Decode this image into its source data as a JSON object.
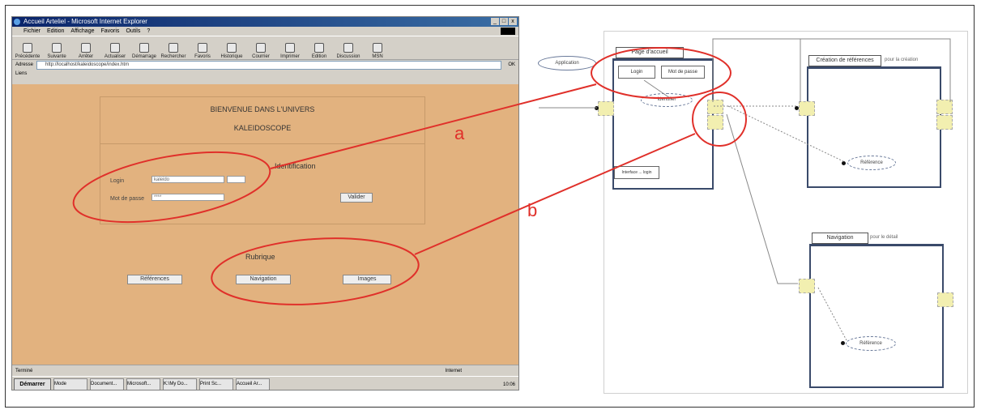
{
  "browser": {
    "title": "Accueil Arteliel - Microsoft Internet Explorer",
    "window_controls": [
      "_",
      "□",
      "x"
    ],
    "menu": [
      "Fichier",
      "Edition",
      "Affichage",
      "Favoris",
      "Outils",
      "?"
    ],
    "toolbar": [
      "Précédente",
      "Suivante",
      "Arrêter",
      "Actualiser",
      "Démarrage",
      "Rechercher",
      "Favoris",
      "Historique",
      "Courrier",
      "Imprimer",
      "Edition",
      "Discussion",
      "MSN"
    ],
    "address_label": "Adresse",
    "address_value": "http://localhost/kaleidoscope/index.htm",
    "go_label": "OK",
    "links_label": "Liens",
    "status_text": "Terminé",
    "status_zone": "Internet",
    "taskbar_start": "Démarrer",
    "taskbar_tasks": [
      "Mode",
      "Document...",
      "Microsoft...",
      "K:\\My Do...",
      "Print Sc...",
      "Accueil Ar..."
    ],
    "taskbar_tray": "10:06"
  },
  "page": {
    "welcome_line1": "BIENVENUE DANS L'UNIVERS",
    "welcome_line2": "KALEIDOSCOPE",
    "identification_title": "Identification",
    "login_label": "Login",
    "login_value": "kaleido",
    "password_label": "Mot de passe",
    "password_value": "****",
    "validate_button": "Valider",
    "rubrique_title": "Rubrique",
    "references_button": "Références",
    "navigation_button": "Navigation",
    "images_button": "Images"
  },
  "callouts": {
    "a": "a",
    "b": "b"
  },
  "diagram": {
    "application_node": "Application",
    "page_accueil_tab": "Page d'accueil",
    "login_node": "Login",
    "password_node": "Mot de passe",
    "identifier_node": "Identifier",
    "inner_small_label": "Interface ... login",
    "creation_tab": "Création de références",
    "creation_side_label": "pour la création",
    "reference_node_1": "Référence",
    "navigation_tab": "Navigation",
    "navigation_side_label": "pour le détail",
    "reference_node_2": "Référence"
  },
  "colors": {
    "annotation": "#e0302a",
    "page_background": "#e2b27f",
    "port": "#f2efb0"
  }
}
